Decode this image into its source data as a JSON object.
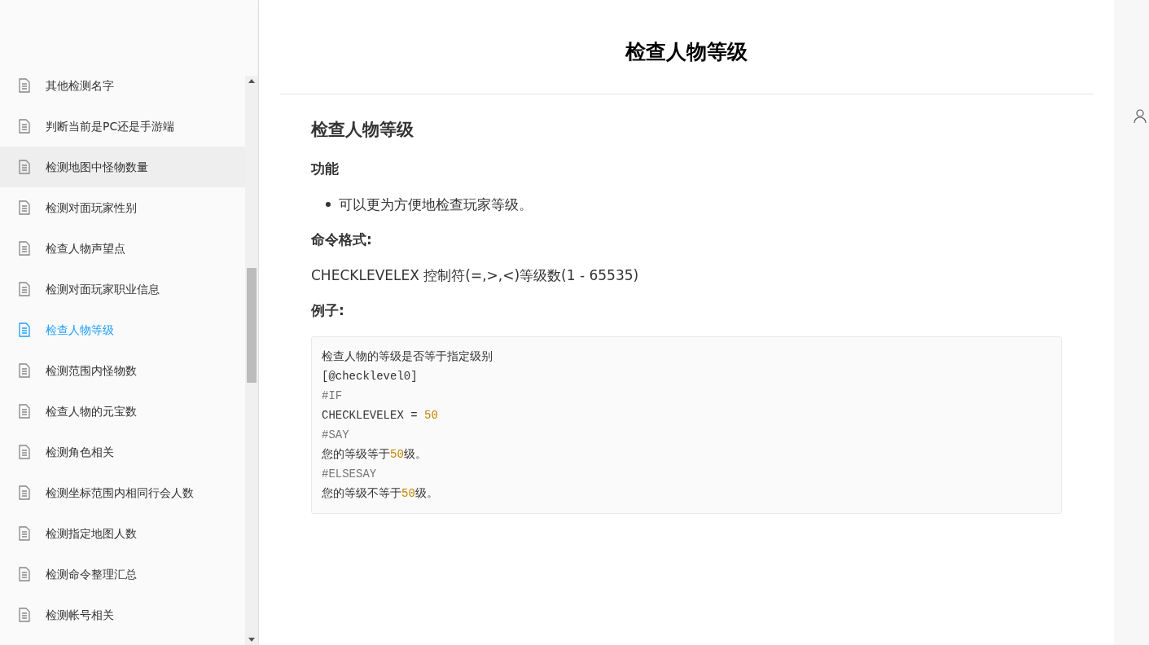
{
  "sidebar": {
    "items": [
      {
        "label": "其他检测名字",
        "selected": false,
        "hovered": false
      },
      {
        "label": "判断当前是PC还是手游端",
        "selected": false,
        "hovered": false
      },
      {
        "label": "检测地图中怪物数量",
        "selected": false,
        "hovered": true
      },
      {
        "label": "检测对面玩家性别",
        "selected": false,
        "hovered": false
      },
      {
        "label": "检查人物声望点",
        "selected": false,
        "hovered": false
      },
      {
        "label": "检测对面玩家职业信息",
        "selected": false,
        "hovered": false
      },
      {
        "label": "检查人物等级",
        "selected": true,
        "hovered": false
      },
      {
        "label": "检测范围内怪物数",
        "selected": false,
        "hovered": false
      },
      {
        "label": "检查人物的元宝数",
        "selected": false,
        "hovered": false
      },
      {
        "label": "检测角色相关",
        "selected": false,
        "hovered": false
      },
      {
        "label": "检测坐标范围内相同行会人数",
        "selected": false,
        "hovered": false
      },
      {
        "label": "检测指定地图人数",
        "selected": false,
        "hovered": false
      },
      {
        "label": "检测命令整理汇总",
        "selected": false,
        "hovered": false
      },
      {
        "label": "检测帐号相关",
        "selected": false,
        "hovered": false
      }
    ]
  },
  "page": {
    "title": "检查人物等级",
    "blocks": [
      {
        "kind": "h2",
        "text": "检查人物等级"
      },
      {
        "kind": "h3",
        "text": "功能"
      },
      {
        "kind": "bullet",
        "text": "可以更为方便地检查玩家等级。"
      },
      {
        "kind": "h3",
        "text": "命令格式:"
      },
      {
        "kind": "p",
        "text": "CHECKLEVELEX 控制符(=,>,<)等级数(1 - 65535)"
      },
      {
        "kind": "h3",
        "text": "例子:"
      },
      {
        "kind": "code",
        "lines": [
          [
            {
              "kind": "plain",
              "text": "检查人物的等级是否等于指定级别"
            }
          ],
          [
            {
              "kind": "plain",
              "text": "[@checklevel0]"
            }
          ],
          [
            {
              "kind": "comment",
              "text": "#IF"
            }
          ],
          [
            {
              "kind": "plain",
              "text": "CHECKLEVELEX = "
            },
            {
              "kind": "number",
              "text": "50"
            }
          ],
          [
            {
              "kind": "comment",
              "text": "#SAY"
            }
          ],
          [
            {
              "kind": "plain",
              "text": "您的等级等于"
            },
            {
              "kind": "number",
              "text": "50"
            },
            {
              "kind": "plain",
              "text": "级。"
            }
          ],
          [
            {
              "kind": "comment",
              "text": "#ELSESAY"
            }
          ],
          [
            {
              "kind": "plain",
              "text": "您的等级不等于"
            },
            {
              "kind": "number",
              "text": "50"
            },
            {
              "kind": "plain",
              "text": "级。"
            }
          ]
        ]
      }
    ]
  }
}
